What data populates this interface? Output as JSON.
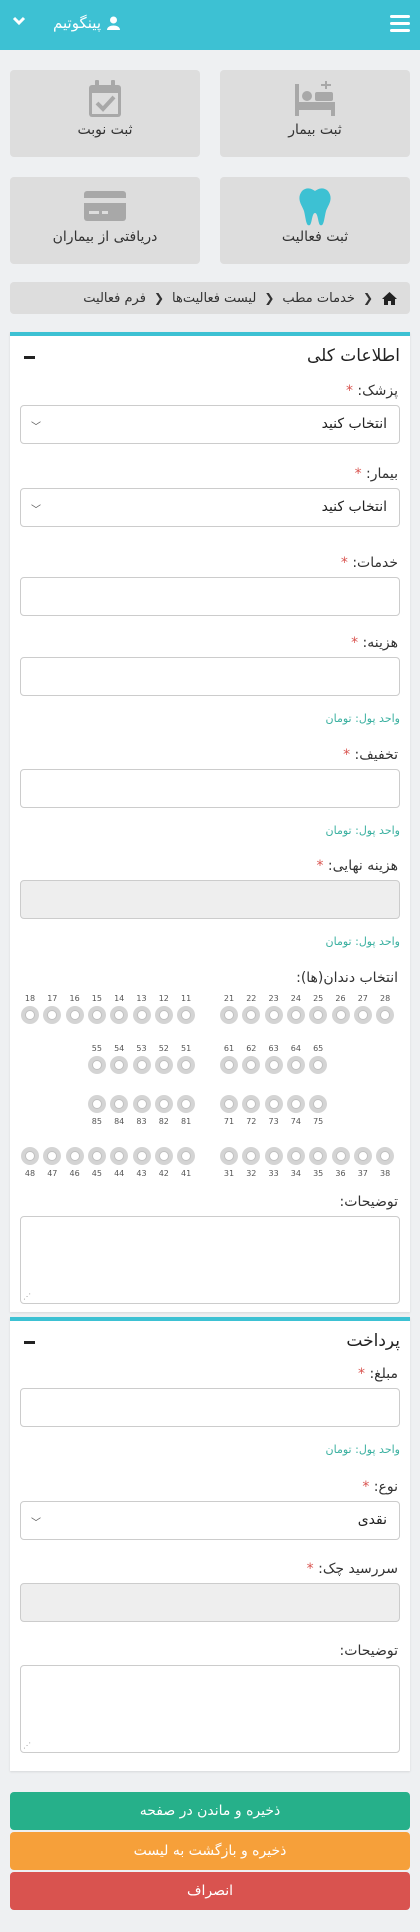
{
  "header": {
    "user_name": "پینگوتیم",
    "menu_icon": "hamburger-icon",
    "user_icon": "user-icon",
    "dropdown_icon": "chevron-down-icon"
  },
  "tiles": [
    {
      "label": "ثبت بیمار",
      "icon": "bed-icon"
    },
    {
      "label": "ثبت نوبت",
      "icon": "calendar-check-icon"
    },
    {
      "label": "ثبت فعالیت",
      "icon": "tooth-icon"
    },
    {
      "label": "دریافتی از بیماران",
      "icon": "credit-card-icon"
    }
  ],
  "breadcrumb": {
    "home_icon": "home-icon",
    "items": [
      "خدمات مطب",
      "لیست فعالیت‌ها",
      "فرم فعالیت"
    ]
  },
  "general": {
    "title": "اطلاعات کلی",
    "doctor_label": "پزشک:",
    "doctor_value": "انتخاب کنید",
    "patient_label": "بیمار:",
    "patient_value": "انتخاب کنید",
    "services_label": "خدمات:",
    "cost_label": "هزینه:",
    "cost_hint": "واحد پول: تومان",
    "discount_label": "تخفیف:",
    "discount_hint": "واحد پول: تومان",
    "final_label": "هزینه نهایی:",
    "final_hint": "واحد پول: تومان",
    "teeth_label": "انتخاب دندان(ها):",
    "notes_label": "توضیحات:",
    "required_mark": "*"
  },
  "teeth": {
    "upper_right": [
      "18",
      "17",
      "16",
      "15",
      "14",
      "13",
      "12",
      "11"
    ],
    "upper_left": [
      "21",
      "22",
      "23",
      "24",
      "25",
      "26",
      "27",
      "28"
    ],
    "primary_upper_right": [
      "55",
      "54",
      "53",
      "52",
      "51"
    ],
    "primary_upper_left": [
      "61",
      "62",
      "63",
      "64",
      "65"
    ],
    "primary_lower_right": [
      "85",
      "84",
      "83",
      "82",
      "81"
    ],
    "primary_lower_left": [
      "71",
      "72",
      "73",
      "74",
      "75"
    ],
    "lower_right": [
      "48",
      "47",
      "46",
      "45",
      "44",
      "43",
      "42",
      "41"
    ],
    "lower_left": [
      "31",
      "32",
      "33",
      "34",
      "35",
      "36",
      "37",
      "38"
    ]
  },
  "payment": {
    "title": "پرداخت",
    "amount_label": "مبلغ:",
    "amount_hint": "واحد پول: تومان",
    "type_label": "نوع:",
    "type_value": "نقدی",
    "cheque_label": "سررسید چک:",
    "notes_label": "توضیحات:"
  },
  "buttons": {
    "save_stay": "ذخیره و ماندن در صفحه",
    "save_back": "ذخیره و بازگشت به لیست",
    "cancel": "انصراف"
  },
  "colors": {
    "accent": "#3dc1d3",
    "green": "#26b08a",
    "orange": "#f6a03a",
    "red": "#d9534f"
  }
}
